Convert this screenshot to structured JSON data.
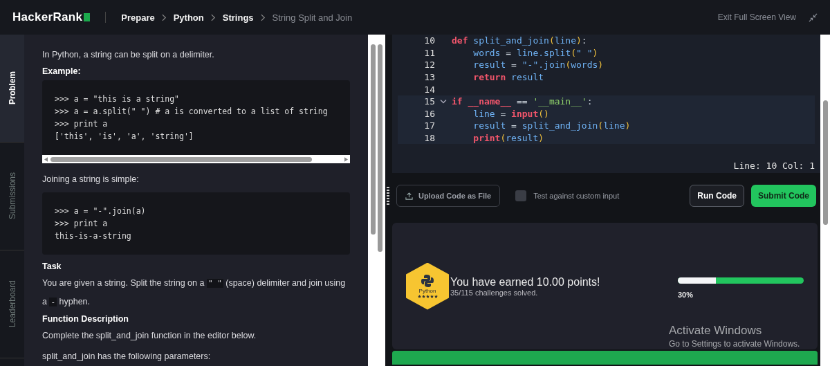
{
  "header": {
    "logo": "HackerRank",
    "breadcrumbs": [
      {
        "label": "Prepare",
        "current": false
      },
      {
        "label": "Python",
        "current": false
      },
      {
        "label": "Strings",
        "current": false
      },
      {
        "label": "String Split and Join",
        "current": true
      }
    ],
    "exit_label": "Exit Full Screen View"
  },
  "side_tabs": [
    {
      "label": "Problem",
      "selected": true
    },
    {
      "label": "Submissions",
      "selected": false
    },
    {
      "label": "Leaderboard",
      "selected": false
    }
  ],
  "problem": {
    "blocks": [
      {
        "kind": "text",
        "parts": [
          {
            "text": "In Python, a string can be split on a delimiter.",
            "code": false
          }
        ]
      },
      {
        "kind": "heading",
        "text": "Example:"
      },
      {
        "kind": "code",
        "scroll": true,
        "lines": [
          ">>> a = \"this is a string\"",
          ">>> a = a.split(\" \") # a is converted to a list of string",
          ">>> print a",
          "['this', 'is', 'a', 'string']"
        ]
      },
      {
        "kind": "text",
        "parts": [
          {
            "text": "Joining a string is simple:",
            "code": false
          }
        ]
      },
      {
        "kind": "code",
        "scroll": false,
        "lines": [
          ">>> a = \"-\".join(a)",
          ">>> print a",
          "this-is-a-string"
        ]
      },
      {
        "kind": "heading",
        "text": "Task"
      },
      {
        "kind": "text",
        "parts": [
          {
            "text": "You are given a string. Split the string on a ",
            "code": false
          },
          {
            "text": "\" \"",
            "code": true
          },
          {
            "text": " (space) delimiter and join using a ",
            "code": false
          },
          {
            "text": "-",
            "code": true
          },
          {
            "text": " hyphen.",
            "code": false
          }
        ]
      },
      {
        "kind": "heading",
        "text": "Function Description"
      },
      {
        "kind": "text",
        "parts": [
          {
            "text": "Complete the split_and_join function in the editor below.",
            "code": false
          }
        ]
      },
      {
        "kind": "text",
        "parts": [
          {
            "text": "split_and_join has the following parameters:",
            "code": false
          }
        ]
      }
    ]
  },
  "editor": {
    "lines": [
      {
        "number": "10",
        "fold": false,
        "tokens": [
          {
            "kind": "keyword",
            "text": "def"
          },
          {
            "kind": "plain",
            "text": " split_and_join"
          },
          {
            "kind": "paren",
            "text": "("
          },
          {
            "kind": "plain",
            "text": "line"
          },
          {
            "kind": "paren",
            "text": ")"
          },
          {
            "kind": "op",
            "text": ":"
          }
        ]
      },
      {
        "number": "11",
        "fold": false,
        "tokens": [
          {
            "kind": "plain",
            "text": "    words "
          },
          {
            "kind": "op",
            "text": "="
          },
          {
            "kind": "plain",
            "text": " line.split"
          },
          {
            "kind": "paren",
            "text": "("
          },
          {
            "kind": "plain",
            "text": "\" \""
          },
          {
            "kind": "paren",
            "text": ")"
          }
        ]
      },
      {
        "number": "12",
        "fold": false,
        "tokens": [
          {
            "kind": "plain",
            "text": "    result "
          },
          {
            "kind": "op",
            "text": "="
          },
          {
            "kind": "plain",
            "text": " \"-\".join"
          },
          {
            "kind": "paren",
            "text": "("
          },
          {
            "kind": "plain",
            "text": "words"
          },
          {
            "kind": "paren",
            "text": ")"
          }
        ]
      },
      {
        "number": "13",
        "fold": false,
        "tokens": [
          {
            "kind": "keyword",
            "text": "    return"
          },
          {
            "kind": "plain",
            "text": " result"
          }
        ]
      },
      {
        "number": "14",
        "fold": false
      },
      {
        "number": "15",
        "fold": true,
        "tokens": [
          {
            "kind": "keyword",
            "text": "if __name__"
          },
          {
            "kind": "op",
            "text": " == "
          },
          {
            "kind": "string",
            "text": "'__main__'"
          },
          {
            "kind": "op",
            "text": ":"
          }
        ]
      },
      {
        "number": "16",
        "fold": false,
        "tokens": [
          {
            "kind": "plain",
            "text": "    line "
          },
          {
            "kind": "op",
            "text": "="
          },
          {
            "kind": "keyword",
            "text": " input"
          },
          {
            "kind": "paren",
            "text": "()"
          }
        ]
      },
      {
        "number": "17",
        "fold": false,
        "tokens": [
          {
            "kind": "plain",
            "text": "    result "
          },
          {
            "kind": "op",
            "text": "="
          },
          {
            "kind": "plain",
            "text": " split_and_join"
          },
          {
            "kind": "paren",
            "text": "("
          },
          {
            "kind": "plain",
            "text": "line"
          },
          {
            "kind": "paren",
            "text": ")"
          }
        ]
      },
      {
        "number": "18",
        "fold": false,
        "tokens": [
          {
            "kind": "keyword",
            "text": "    print"
          },
          {
            "kind": "paren",
            "text": "("
          },
          {
            "kind": "plain",
            "text": "result"
          },
          {
            "kind": "paren",
            "text": ")"
          }
        ]
      }
    ],
    "status": "Line: 10 Col: 1"
  },
  "actions": {
    "upload": "Upload Code as File",
    "custom_input": {
      "label": "Test against custom input",
      "checked": false
    },
    "run": "Run Code",
    "submit": "Submit Code"
  },
  "result": {
    "badge": {
      "label": "Python",
      "stars": 5
    },
    "title": "You have earned 10.00 points!",
    "subtitle": "35/115 challenges solved.",
    "progress": {
      "level": 0.3,
      "reading": "30%"
    }
  },
  "os_notice": {
    "title": "Activate Windows",
    "text": "Go to Settings to activate Windows."
  }
}
